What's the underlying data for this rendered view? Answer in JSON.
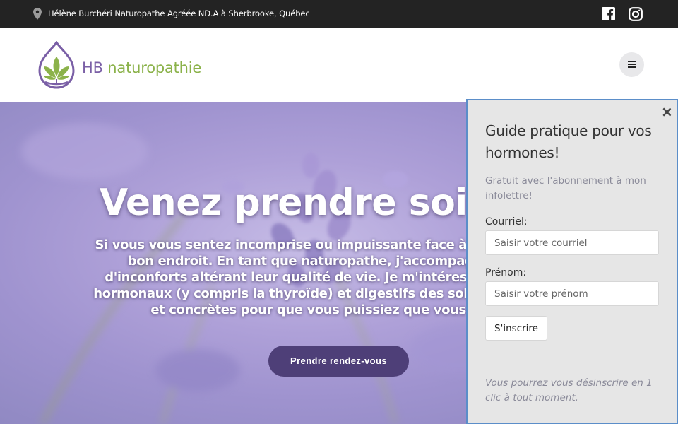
{
  "topbar": {
    "address": "Hélène Burchéri Naturopathe Agréée ND.A à Sherbrooke, Québec"
  },
  "header": {
    "logo_hb": "HB",
    "logo_name": "naturopathie"
  },
  "hero": {
    "title": "Venez prendre soin de",
    "text": "Si vous vous sentez incomprise ou impuissante face à vos trou êtes au bon endroit. En tant que naturopathe, j'accompagn souffrent d'inconforts altérant leur qualité de vie. Je m'intéres aux problèmes hormonaux (y compris la thyroïde) et digestifs des solutions naturelles et concrètes pour que vous puissiez que vous méritez.",
    "button": "Prendre rendez-vous"
  },
  "popup": {
    "close": "×",
    "title": "Guide pratique pour vos hormones!",
    "subtitle": "Gratuit avec l'abonnement à mon infolettre!",
    "email_label": "Courriel:",
    "email_placeholder": "Saisir votre courriel",
    "firstname_label": "Prénom:",
    "firstname_placeholder": "Saisir votre prénom",
    "submit": "S'inscrire",
    "note": "Vous pourrez vous désinscrire en 1 clic à tout moment."
  },
  "colors": {
    "topbar": "#232323",
    "brand_purple": "#7a5fa6",
    "brand_green": "#8bb24a",
    "button": "#4e3f78",
    "popup_border": "#5b8ec9"
  },
  "icons": {
    "pin": "map-pin-icon",
    "facebook": "facebook-icon",
    "instagram": "instagram-icon",
    "menu": "hamburger-icon"
  }
}
